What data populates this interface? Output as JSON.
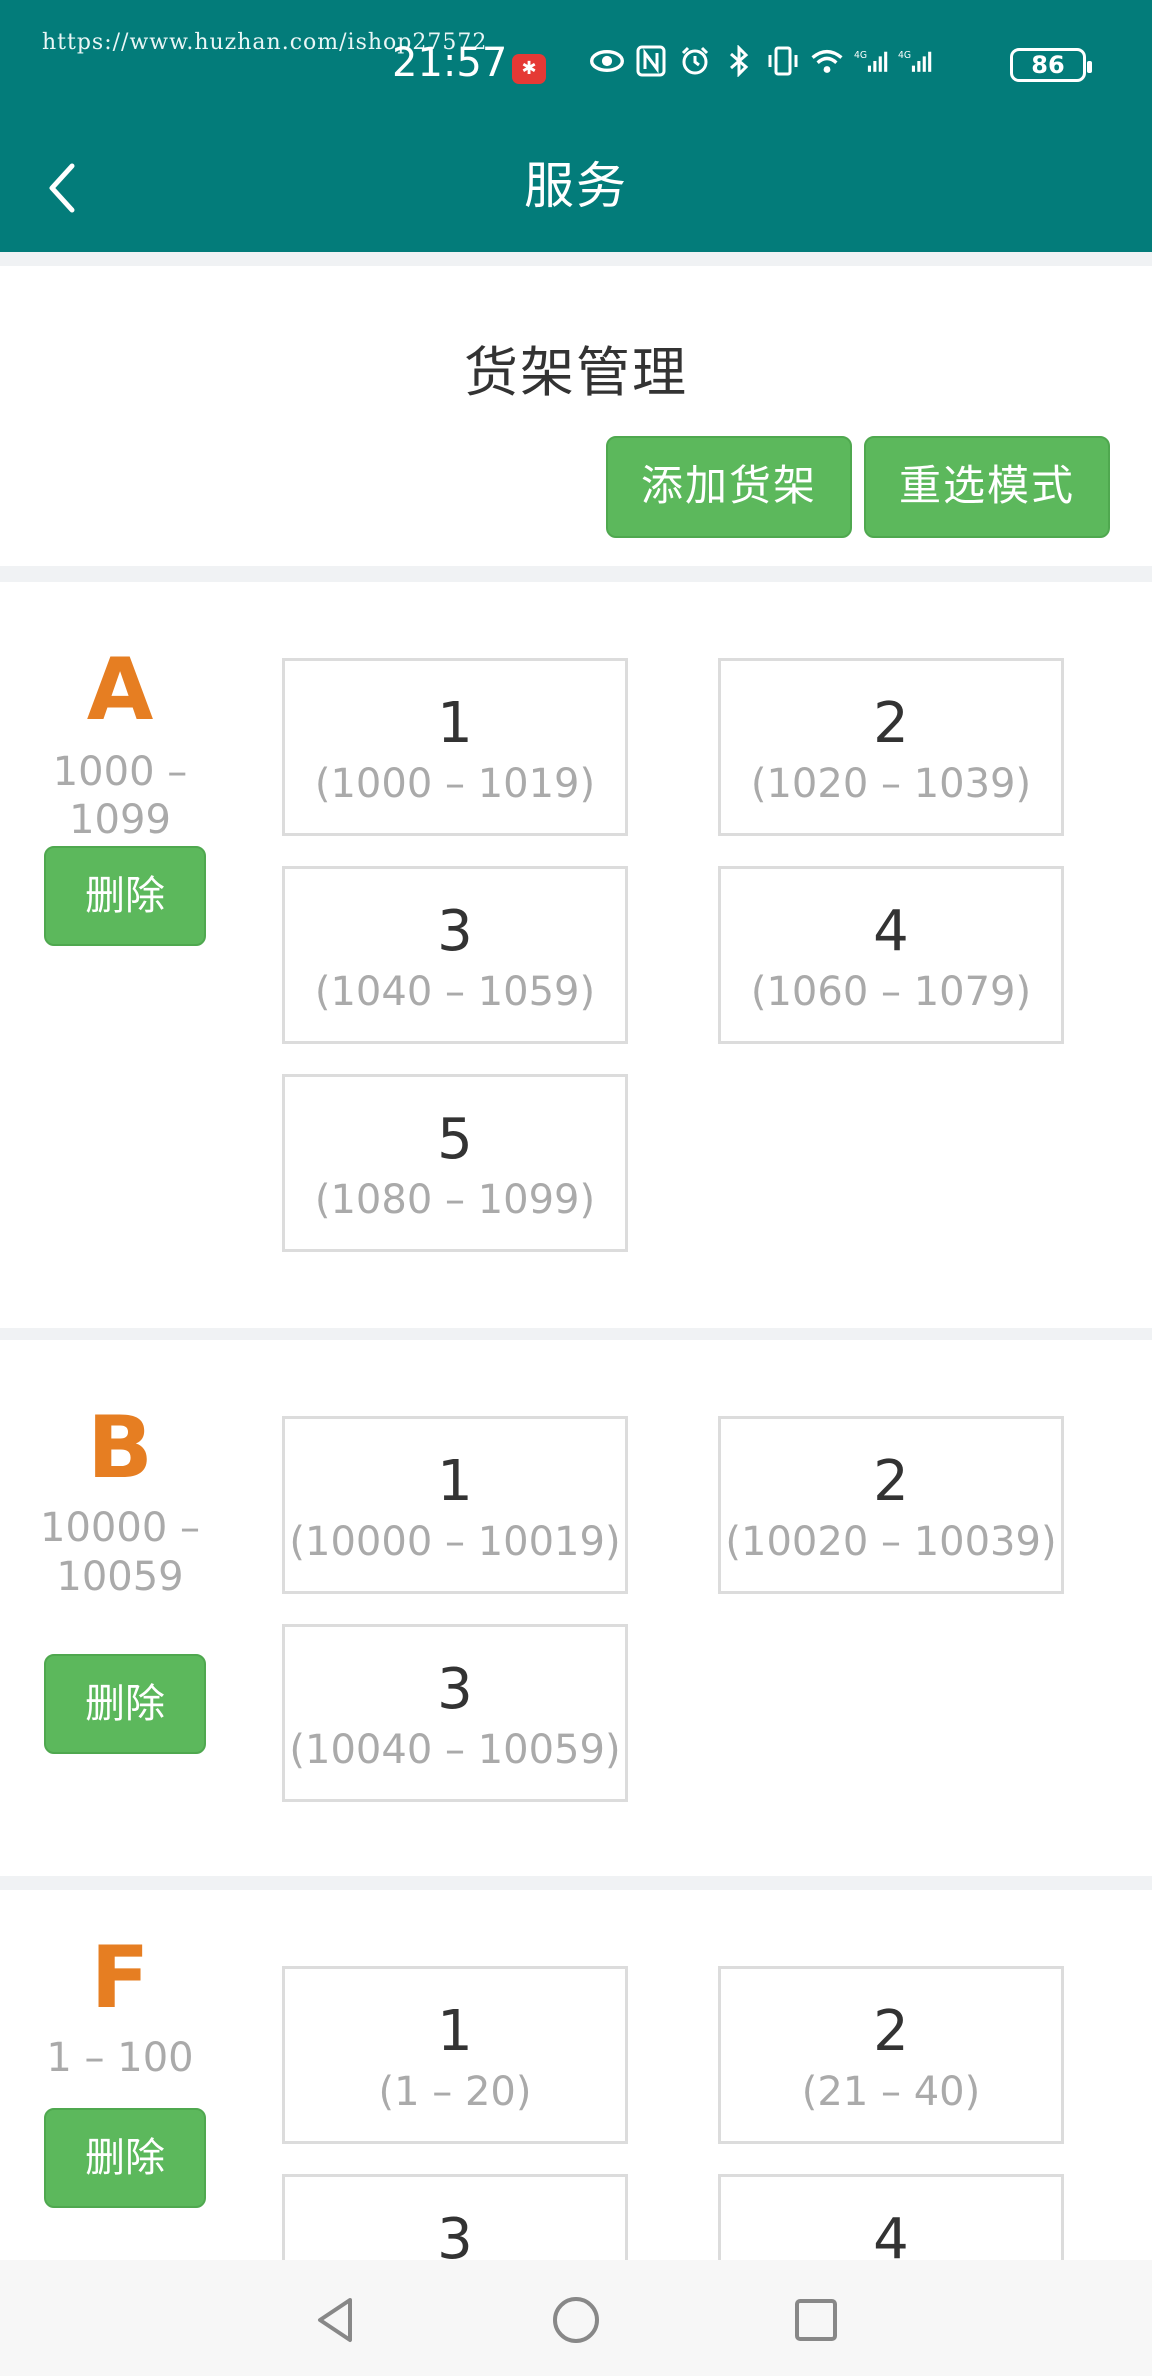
{
  "status_bar": {
    "watermark": "https://www.huzhan.com/ishop27572",
    "time": "21:57",
    "battery": "86",
    "icons": [
      "eye-icon",
      "nfc-icon",
      "alarm-icon",
      "bluetooth-icon",
      "vibrate-icon",
      "wifi-icon",
      "signal-4g-icon",
      "signal-4g-icon"
    ]
  },
  "header": {
    "title": "服务"
  },
  "panel": {
    "title": "货架管理",
    "add_label": "添加货架",
    "reset_label": "重选模式"
  },
  "sections": [
    {
      "letter": "A",
      "range": "1000 – 1099",
      "delete_label": "删除",
      "cells": [
        {
          "num": "1",
          "range": "(1000 – 1019)"
        },
        {
          "num": "2",
          "range": "(1020 – 1039)"
        },
        {
          "num": "3",
          "range": "(1040 – 1059)"
        },
        {
          "num": "4",
          "range": "(1060 – 1079)"
        },
        {
          "num": "5",
          "range": "(1080 – 1099)"
        }
      ]
    },
    {
      "letter": "B",
      "range": "10000 – 10059",
      "delete_label": "删除",
      "cells": [
        {
          "num": "1",
          "range": "(10000 – 10019)"
        },
        {
          "num": "2",
          "range": "(10020 – 10039)"
        },
        {
          "num": "3",
          "range": "(10040 – 10059)"
        }
      ]
    },
    {
      "letter": "F",
      "range": "1 – 100",
      "delete_label": "删除",
      "cells": [
        {
          "num": "1",
          "range": "(1 – 20)"
        },
        {
          "num": "2",
          "range": "(21 – 40)"
        },
        {
          "num": "3",
          "range": ""
        },
        {
          "num": "4",
          "range": ""
        }
      ]
    }
  ]
}
